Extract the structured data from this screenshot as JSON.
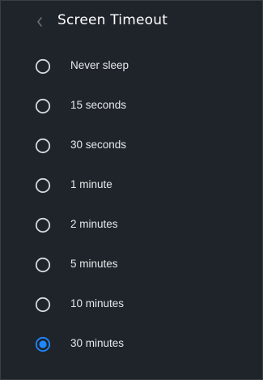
{
  "header": {
    "title": "Screen Timeout",
    "back_icon": "chevron-left-icon"
  },
  "options": [
    {
      "label": "Never sleep",
      "selected": false
    },
    {
      "label": "15 seconds",
      "selected": false
    },
    {
      "label": "30 seconds",
      "selected": false
    },
    {
      "label": "1 minute",
      "selected": false
    },
    {
      "label": "2 minutes",
      "selected": false
    },
    {
      "label": "5 minutes",
      "selected": false
    },
    {
      "label": "10 minutes",
      "selected": false
    },
    {
      "label": "30 minutes",
      "selected": true
    }
  ],
  "colors": {
    "background": "#1f242b",
    "accent": "#1e88ff",
    "radio_unselected": "#d6d9dc"
  }
}
